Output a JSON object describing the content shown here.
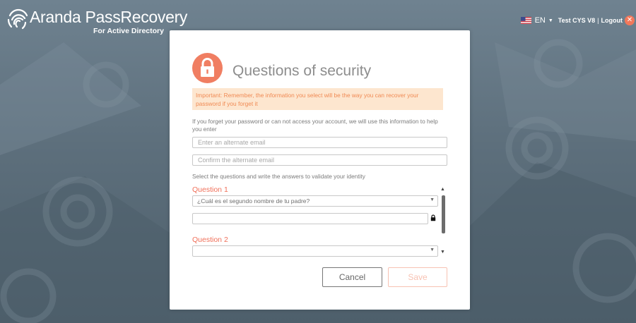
{
  "brand": {
    "title": "Aranda PassRecovery",
    "subtitle": "For Active Directory",
    "logo_icon": "fingerprint-icon"
  },
  "topbar": {
    "flag_icon": "us-flag-icon",
    "language": "EN",
    "language_caret": "▼",
    "user": "Test CYS V8",
    "separator": "|",
    "logout": "Logout",
    "close_icon": "close-icon",
    "close_glyph": "✕"
  },
  "card": {
    "lock_icon": "padlock-icon",
    "title": "Questions of security",
    "notice": "Important: Remember, the information you select will be the way you can recover your password if you forget it",
    "description": "If you forget your password or can not access your account, we will use this information to help you enter",
    "email_placeholder": "Enter an alternate email",
    "confirm_email_placeholder": "Confirm the alternate email",
    "select_instructions": "Select the questions and write the answers to validate your identity",
    "questions": [
      {
        "label": "Question 1",
        "selected": "¿Cuál es el segundo nombre de tu padre?",
        "answer": ""
      },
      {
        "label": "Question 2",
        "selected": "",
        "answer": ""
      }
    ],
    "select_arrow": "▼",
    "scroll_up": "▲",
    "scroll_down": "▼",
    "cancel_label": "Cancel",
    "save_label": "Save"
  },
  "colors": {
    "accent": "#f07e62",
    "notice_bg": "#fde6cf",
    "notice_text": "#f08a54",
    "background": "#5d6f7c",
    "save_disabled": "#f8c2b3"
  }
}
